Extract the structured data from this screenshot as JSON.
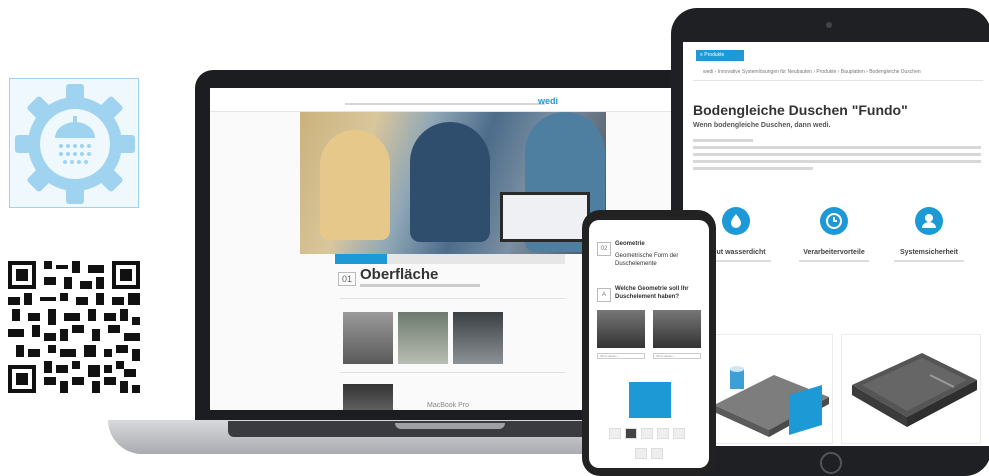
{
  "colors": {
    "accent": "#1d9ad6",
    "icon_tile_bg": "#eef8fd"
  },
  "side_icons": {
    "top": "shower-gear-icon",
    "bottom": "qr-code"
  },
  "laptop": {
    "brand_label": "MacBook Pro",
    "site_logo": "wedi",
    "section_number": "01",
    "section_title": "Oberfläche"
  },
  "tablet": {
    "tab_button": "≡ Produkte",
    "breadcrumb": "wedi - Innovative Systemlösungen für Neubauten  ›  Produkte  ›  Bauplatten  ›  Bodengleiche Duschen",
    "heading": "Bodengleiche Duschen \"Fundo\"",
    "subheading": "Wenn bodengleiche Duschen, dann wedi.",
    "features": [
      {
        "icon": "water-drop-icon",
        "title": "solut wasserdicht"
      },
      {
        "icon": "clock-icon",
        "title": "Verarbeitervorteile"
      },
      {
        "icon": "worker-icon",
        "title": "Systemsicherheit"
      }
    ]
  },
  "phone": {
    "step1_number": "02",
    "step1_title": "Geometrie",
    "step1_subtitle": "Geometrische Form der Duschelemente",
    "step2_number": "A",
    "step2_title": "Welche Geometrie soll Ihr Duschelement haben?",
    "select_left": "– Bitte wählen –",
    "select_right": "– Bitte wählen –"
  }
}
